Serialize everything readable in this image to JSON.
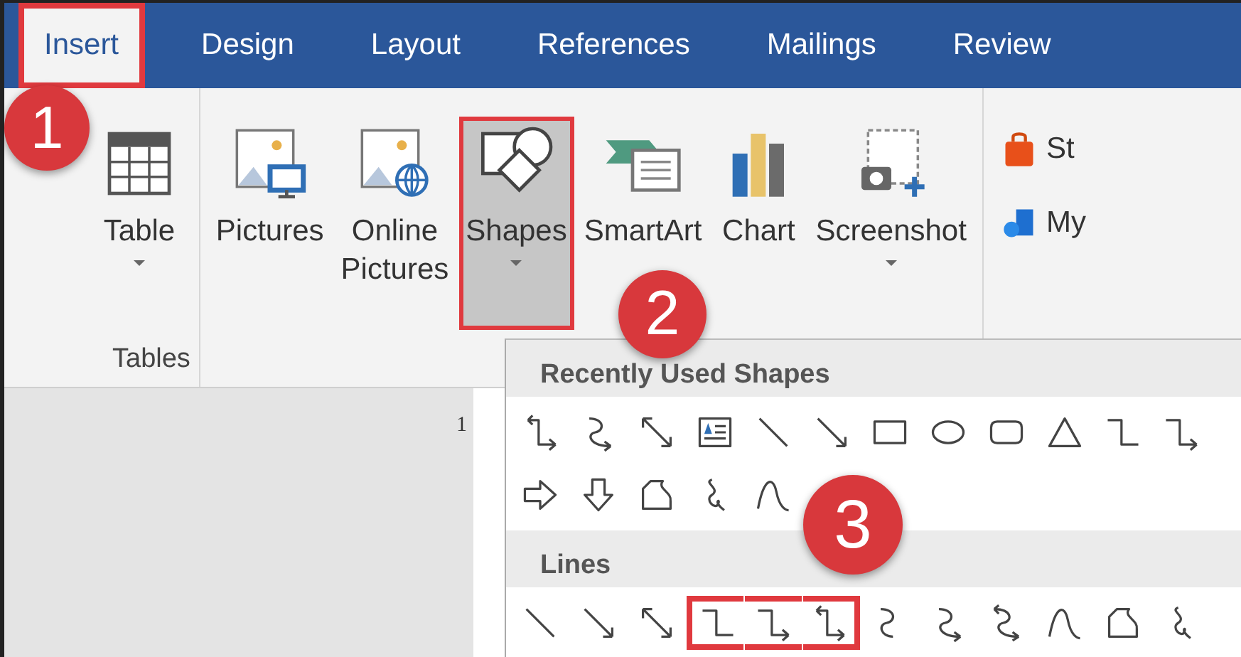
{
  "tabs": [
    {
      "label": "Insert",
      "selected": true,
      "highlighted": true
    },
    {
      "label": "Design",
      "selected": false,
      "highlighted": false
    },
    {
      "label": "Layout",
      "selected": false,
      "highlighted": false
    },
    {
      "label": "References",
      "selected": false,
      "highlighted": false
    },
    {
      "label": "Mailings",
      "selected": false,
      "highlighted": false
    },
    {
      "label": "Review",
      "selected": false,
      "highlighted": false
    }
  ],
  "ribbon": {
    "groups": [
      {
        "label": "Tables",
        "buttons": [
          {
            "kind": "table",
            "label": "Table",
            "dropdown": true,
            "pressed": false,
            "highlighted": false
          }
        ]
      },
      {
        "buttons": [
          {
            "kind": "pictures",
            "label": "Pictures",
            "dropdown": false,
            "pressed": false,
            "highlighted": false
          },
          {
            "kind": "online-pictures",
            "label": "Online Pictures",
            "dropdown": false,
            "pressed": false,
            "highlighted": false
          },
          {
            "kind": "shapes",
            "label": "Shapes",
            "dropdown": true,
            "pressed": true,
            "highlighted": true
          },
          {
            "kind": "smartart",
            "label": "SmartArt",
            "dropdown": false,
            "pressed": false,
            "highlighted": false
          },
          {
            "kind": "chart",
            "label": "Chart",
            "dropdown": false,
            "pressed": false,
            "highlighted": false
          },
          {
            "kind": "screenshot",
            "label": "Screenshot",
            "dropdown": true,
            "pressed": false,
            "highlighted": false
          }
        ]
      }
    ],
    "small_buttons": [
      {
        "kind": "store",
        "label": "St"
      },
      {
        "kind": "addins",
        "label": "My"
      }
    ]
  },
  "document": {
    "ruler_mark": "1"
  },
  "shapes_menu": {
    "sections": [
      {
        "title": "Recently Used Shapes",
        "shapes": [
          {
            "kind": "elbow-double-arrow",
            "highlighted": false
          },
          {
            "kind": "curved-arrow",
            "highlighted": false
          },
          {
            "kind": "double-arrow",
            "highlighted": false
          },
          {
            "kind": "text-box",
            "highlighted": false
          },
          {
            "kind": "line",
            "highlighted": false
          },
          {
            "kind": "arrow",
            "highlighted": false
          },
          {
            "kind": "rectangle",
            "highlighted": false
          },
          {
            "kind": "oval",
            "highlighted": false
          },
          {
            "kind": "rounded-rectangle",
            "highlighted": false
          },
          {
            "kind": "triangle",
            "highlighted": false
          },
          {
            "kind": "elbow",
            "highlighted": false
          },
          {
            "kind": "elbow-arrow",
            "highlighted": false
          },
          {
            "kind": "right-arrow",
            "highlighted": false
          },
          {
            "kind": "down-arrow",
            "highlighted": false
          },
          {
            "kind": "freeform",
            "highlighted": false
          },
          {
            "kind": "scribble",
            "highlighted": false
          },
          {
            "kind": "curve",
            "highlighted": false
          }
        ]
      },
      {
        "title": "Lines",
        "shapes": [
          {
            "kind": "line",
            "highlighted": false
          },
          {
            "kind": "arrow",
            "highlighted": false
          },
          {
            "kind": "double-arrow",
            "highlighted": false
          },
          {
            "kind": "elbow",
            "highlighted": true
          },
          {
            "kind": "elbow-arrow",
            "highlighted": true
          },
          {
            "kind": "elbow-double-arrow",
            "highlighted": true
          },
          {
            "kind": "curved",
            "highlighted": false
          },
          {
            "kind": "curved-arrow",
            "highlighted": false
          },
          {
            "kind": "curved-double-arrow",
            "highlighted": false
          },
          {
            "kind": "curve",
            "highlighted": false
          },
          {
            "kind": "freeform",
            "highlighted": false
          },
          {
            "kind": "scribble",
            "highlighted": false
          }
        ]
      }
    ]
  },
  "callouts": [
    {
      "label": "1"
    },
    {
      "label": "2"
    },
    {
      "label": "3"
    }
  ]
}
